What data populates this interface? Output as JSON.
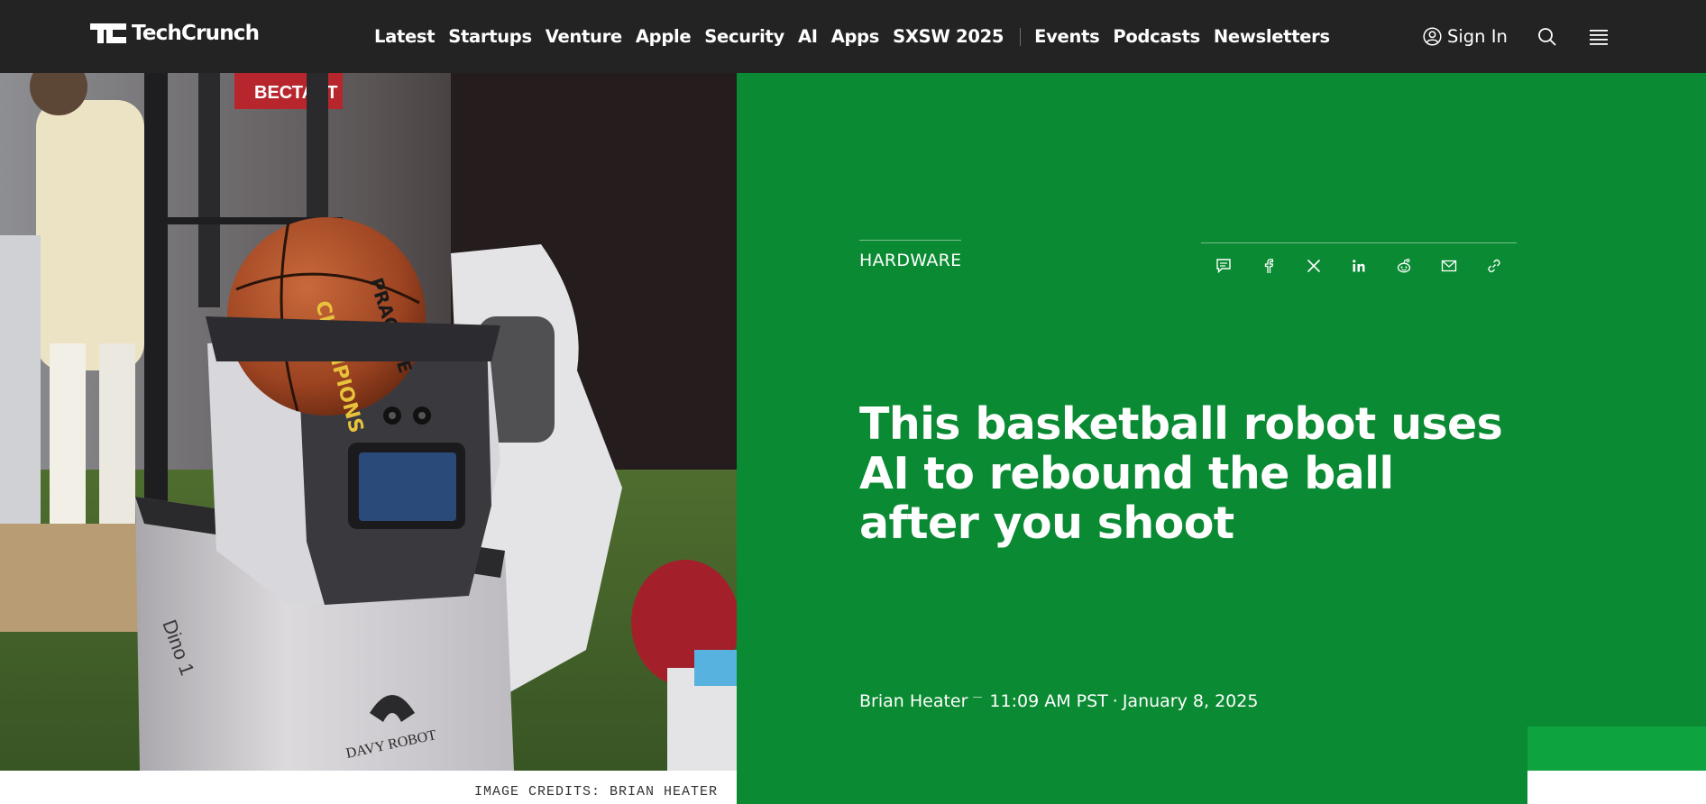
{
  "brand": {
    "name": "TechCrunch"
  },
  "nav": {
    "primary": [
      "Latest",
      "Startups",
      "Venture",
      "Apple",
      "Security",
      "AI",
      "Apps",
      "SXSW 2025"
    ],
    "secondary": [
      "Events",
      "Podcasts",
      "Newsletters"
    ],
    "sign_in": "Sign In"
  },
  "article": {
    "category": "HARDWARE",
    "title": "This basketball robot uses AI to rebound the ball after you shoot",
    "author": "Brian Heater",
    "time": "11:09 AM PST",
    "date_sep": "·",
    "date": "January 8, 2025",
    "image_credits": "IMAGE CREDITS: BRIAN HEATER"
  },
  "hero_image": {
    "robot_logo_text": "DAVY ROBOT",
    "robot_model_text": "Dino 1",
    "ball_text": "CHAMPIONS",
    "ball_text_2": "PRACTICE",
    "booth_sign_text": "ВЕСТАРТ"
  },
  "share": [
    "comment-icon",
    "facebook-icon",
    "x-icon",
    "linkedin-icon",
    "reddit-icon",
    "email-icon",
    "link-icon"
  ],
  "colors": {
    "nav_bg": "#232323",
    "panel_green": "#0a8a32",
    "accent_green": "#0da440",
    "text_white": "#ffffff"
  }
}
